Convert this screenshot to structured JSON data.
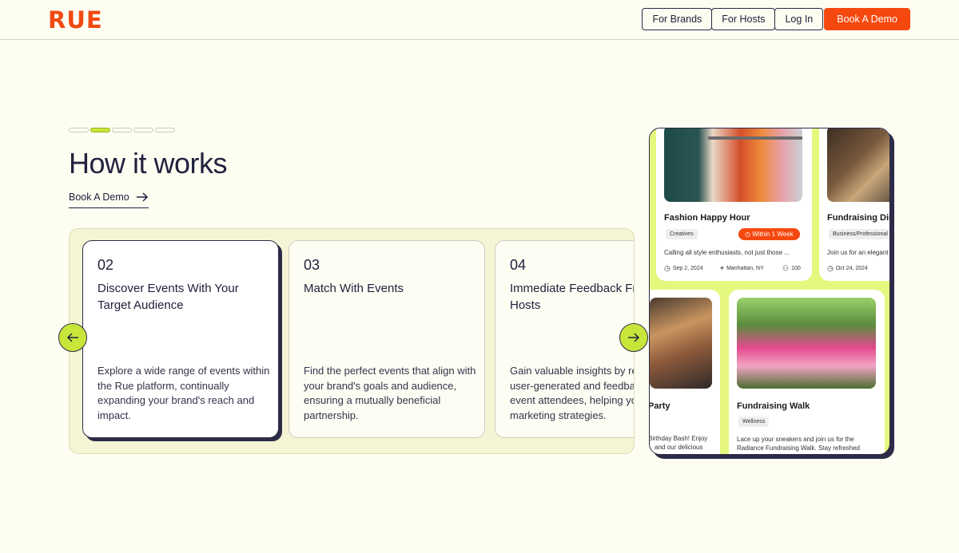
{
  "header": {
    "logo": "RUE",
    "nav": [
      "For Brands",
      "For Hosts",
      "Log In"
    ],
    "cta": "Book A Demo"
  },
  "section": {
    "title": "How it works",
    "link_label": "Book A Demo",
    "progress_total": 5,
    "progress_active": 2
  },
  "steps": [
    {
      "num": "02",
      "title": "Discover Events With Your Target Audience",
      "desc": "Explore a wide range of events within the Rue platform, continually expanding your brand's reach and impact."
    },
    {
      "num": "03",
      "title": "Match With Events",
      "desc": "Find the perfect events that align with your brand's goals and audience, ensuring a mutually beneficial partnership."
    },
    {
      "num": "04",
      "title": "Immediate Feedback From Hosts",
      "desc": "Gain valuable insights by reviewing user-generated and feedback from event attendees, helping you refine marketing strategies."
    }
  ],
  "events": {
    "fashion": {
      "title": "Fashion Happy Hour",
      "tag": "Creatives",
      "badge": "Within 1 Week",
      "snippet": "Calling all style enthusiasts, not just those ...",
      "date": "Sep 2, 2024",
      "location": "Manhattan, NY",
      "count": "100"
    },
    "dinner": {
      "title": "Fundraising Dinner",
      "tag": "Business/Professional",
      "snippet": "Join us for an elegant",
      "date": "Oct 24, 2024"
    },
    "party": {
      "title": "Party",
      "snippet_1": "Birthday Bash! Enjoy",
      "snippet_2": "and our delicious"
    },
    "walk": {
      "title": "Fundraising Walk",
      "tag": "Wellness",
      "snippet_1": "Lace up your sneakers and join us for the",
      "snippet_2": "Radiance Fundraising Walk. Stay refreshed"
    }
  },
  "colors": {
    "accent": "#f5480f",
    "lime": "#c8e63a",
    "ink": "#22223f",
    "background": "#fdfdf2"
  }
}
